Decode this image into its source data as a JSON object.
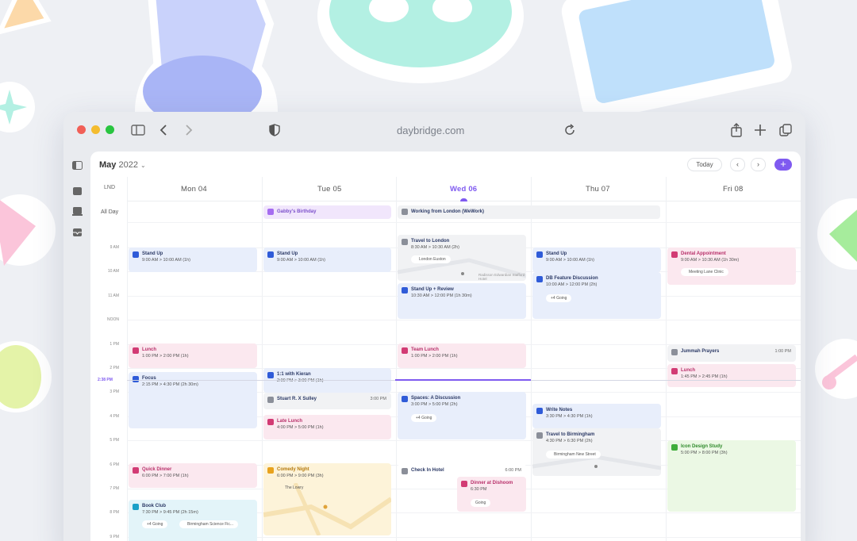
{
  "browser": {
    "url": "daybridge.com"
  },
  "calendar": {
    "month": "May",
    "year": "2022",
    "today_label": "Today",
    "prev_label": "‹",
    "next_label": "›",
    "add_label": "+",
    "timezone": "LND",
    "all_day_label": "All Day",
    "current_time": "2:38 PM",
    "days": [
      {
        "label": "Mon 04",
        "today": false
      },
      {
        "label": "Tue 05",
        "today": false
      },
      {
        "label": "Wed 06",
        "today": true
      },
      {
        "label": "Thu 07",
        "today": false
      },
      {
        "label": "Fri 08",
        "today": false
      }
    ],
    "hours": [
      "9 AM",
      "10 AM",
      "11 AM",
      "NOON",
      "1 PM",
      "2 PM",
      "3 PM",
      "4 PM",
      "5 PM",
      "6 PM",
      "7 PM",
      "8 PM",
      "9 PM"
    ],
    "all_day_events": [
      {
        "title": "Gabby's Birthday"
      },
      {
        "title": "Working from London (WeWork)"
      }
    ],
    "events": {
      "mon_standup": {
        "title": "Stand Up",
        "time": "9:00 AM > 10:00 AM (1h)"
      },
      "mon_lunch": {
        "title": "Lunch",
        "time": "1:00 PM > 2:00 PM (1h)"
      },
      "mon_focus": {
        "title": "Focus",
        "time": "2:15 PM > 4:30 PM (2h 30m)"
      },
      "mon_quick_dinner": {
        "title": "Quick Dinner",
        "time": "6:00 PM > 7:00 PM (1h)"
      },
      "mon_book_club": {
        "title": "Book Club",
        "time": "7:30 PM > 9:45 PM (2h 15m)",
        "going": "+4 Going",
        "location": "Birmingham Science Fic..."
      },
      "tue_standup": {
        "title": "Stand Up",
        "time": "9:00 AM > 10:00 AM (1h)"
      },
      "tue_kieran": {
        "title": "1:1 with Kieran",
        "time": "2:00 PM > 3:00 PM (1h)"
      },
      "tue_sulley": {
        "title": "Stuart R. X Sulley",
        "right": "3:00 PM"
      },
      "tue_late_lunch": {
        "title": "Late Lunch",
        "time": "4:00 PM > 5:00 PM (1h)"
      },
      "tue_comedy": {
        "title": "Comedy Night",
        "time": "6:00 PM > 9:00 PM (3h)",
        "location": "The Lowry"
      },
      "wed_travel": {
        "title": "Travel to London",
        "time": "8:30 AM > 10:30 AM (2h)",
        "location": "London Euston",
        "map_label": "Radisson Edwardian Stafford Hotel"
      },
      "wed_standup_review": {
        "title": "Stand Up + Review",
        "time": "10:30 AM > 12:00 PM (1h 30m)"
      },
      "wed_team_lunch": {
        "title": "Team Lunch",
        "time": "1:00 PM > 2:00 PM (1h)"
      },
      "wed_spaces": {
        "title": "Spaces: A Discussion",
        "time": "3:00 PM > 5:00 PM (2h)",
        "going": "+4 Going"
      },
      "wed_checkin": {
        "title": "Check In Hotel",
        "right": "6:00 PM"
      },
      "wed_dishoom": {
        "title": "Dinner at Dishoom",
        "time": "6:30 PM",
        "going": "Going"
      },
      "thu_standup": {
        "title": "Stand Up",
        "time": "9:00 AM > 10:00 AM (1h)"
      },
      "thu_db": {
        "title": "DB Feature Discussion",
        "time": "10:00 AM > 12:00 PM (2h)",
        "going": "+4 Going"
      },
      "thu_notes": {
        "title": "Write Notes",
        "time": "3:30 PM > 4:30 PM (1h)"
      },
      "thu_travel": {
        "title": "Travel to Birmingham",
        "time": "4:30 PM > 6:30 PM (2h)",
        "location": "Birmingham New Street"
      },
      "fri_dental": {
        "title": "Dental Appointment",
        "time": "9:00 AM > 10:30 AM (1h 30m)",
        "location": "Meeting Lane Clinic"
      },
      "fri_jummah": {
        "title": "Jummah Prayers",
        "right": "1:00 PM"
      },
      "fri_lunch": {
        "title": "Lunch",
        "time": "1:45 PM > 2:45 PM (1h)"
      },
      "fri_icon": {
        "title": "Icon Design Study",
        "time": "5:00 PM > 8:00 PM (3h)"
      }
    }
  },
  "colors": {
    "accent": "#7f5af0",
    "blue_event": "#e8eefb",
    "pink_event": "#fbe8ef",
    "green_event": "#ebf8e4"
  }
}
